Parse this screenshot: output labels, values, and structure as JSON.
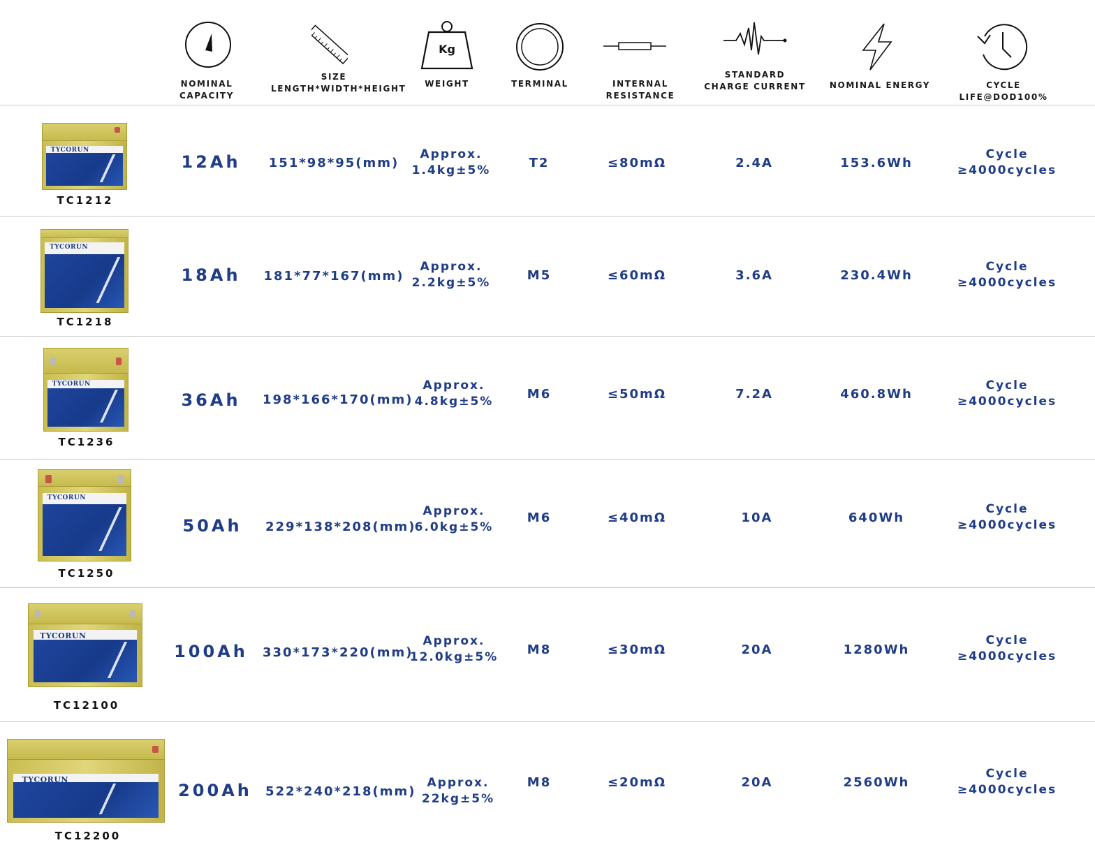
{
  "headers": [
    {
      "label": "NOMINAL CAPACITY",
      "icon": "gauge-icon"
    },
    {
      "label": "SIZE\nLENGTH*WIDTH*HEIGHT",
      "icon": "ruler-icon"
    },
    {
      "label": "WEIGHT",
      "icon": "weight-icon",
      "icon_text": "Kg"
    },
    {
      "label": "TERMINAL",
      "icon": "terminal-icon"
    },
    {
      "label": "INTERNAL RESISTANCE",
      "icon": "resistor-icon"
    },
    {
      "label": "STANDARD\nCHARGE CURRENT",
      "icon": "pulse-icon"
    },
    {
      "label": "NOMINAL ENERGY",
      "icon": "lightning-icon"
    },
    {
      "label": "CYCLE LIFE@DOD100%",
      "icon": "clock-history-icon"
    }
  ],
  "rows": [
    {
      "model": "TC1212",
      "capacity": "12Ah",
      "size": "151*98*95(mm)",
      "weight1": "Approx.",
      "weight2": "1.4kg±5%",
      "terminal": "T2",
      "resistance": "≤80mΩ",
      "current": "2.4A",
      "energy": "153.6Wh",
      "cycle1": "Cycle",
      "cycle2": "≥4000cycles"
    },
    {
      "model": "TC1218",
      "capacity": "18Ah",
      "size": "181*77*167(mm)",
      "weight1": "Approx.",
      "weight2": "2.2kg±5%",
      "terminal": "M5",
      "resistance": "≤60mΩ",
      "current": "3.6A",
      "energy": "230.4Wh",
      "cycle1": "Cycle",
      "cycle2": "≥4000cycles"
    },
    {
      "model": "TC1236",
      "capacity": "36Ah",
      "size": "198*166*170(mm)",
      "weight1": "Approx.",
      "weight2": "4.8kg±5%",
      "terminal": "M6",
      "resistance": "≤50mΩ",
      "current": "7.2A",
      "energy": "460.8Wh",
      "cycle1": "Cycle",
      "cycle2": "≥4000cycles"
    },
    {
      "model": "TC1250",
      "capacity": "50Ah",
      "size": "229*138*208(mm)",
      "weight1": "Approx.",
      "weight2": "6.0kg±5%",
      "terminal": "M6",
      "resistance": "≤40mΩ",
      "current": "10A",
      "energy": "640Wh",
      "cycle1": "Cycle",
      "cycle2": "≥4000cycles"
    },
    {
      "model": "TC12100",
      "capacity": "100Ah",
      "size": "330*173*220(mm)",
      "weight1": "Approx.",
      "weight2": "12.0kg±5%",
      "terminal": "M8",
      "resistance": "≤30mΩ",
      "current": "20A",
      "energy": "1280Wh",
      "cycle1": "Cycle",
      "cycle2": "≥4000cycles"
    },
    {
      "model": "TC12200",
      "capacity": "200Ah",
      "size": "522*240*218(mm)",
      "weight1": "Approx.",
      "weight2": "22kg±5%",
      "terminal": "M8",
      "resistance": "≤20mΩ",
      "current": "20A",
      "energy": "2560Wh",
      "cycle1": "Cycle",
      "cycle2": "≥4000cycles"
    }
  ],
  "battery_label_brand": "TYCORUN",
  "colors": {
    "text_blue": "#1f3c86",
    "battery_gold": "#d4c862",
    "label_blue": "#1f46a0",
    "divider": "#c8c8c8"
  }
}
